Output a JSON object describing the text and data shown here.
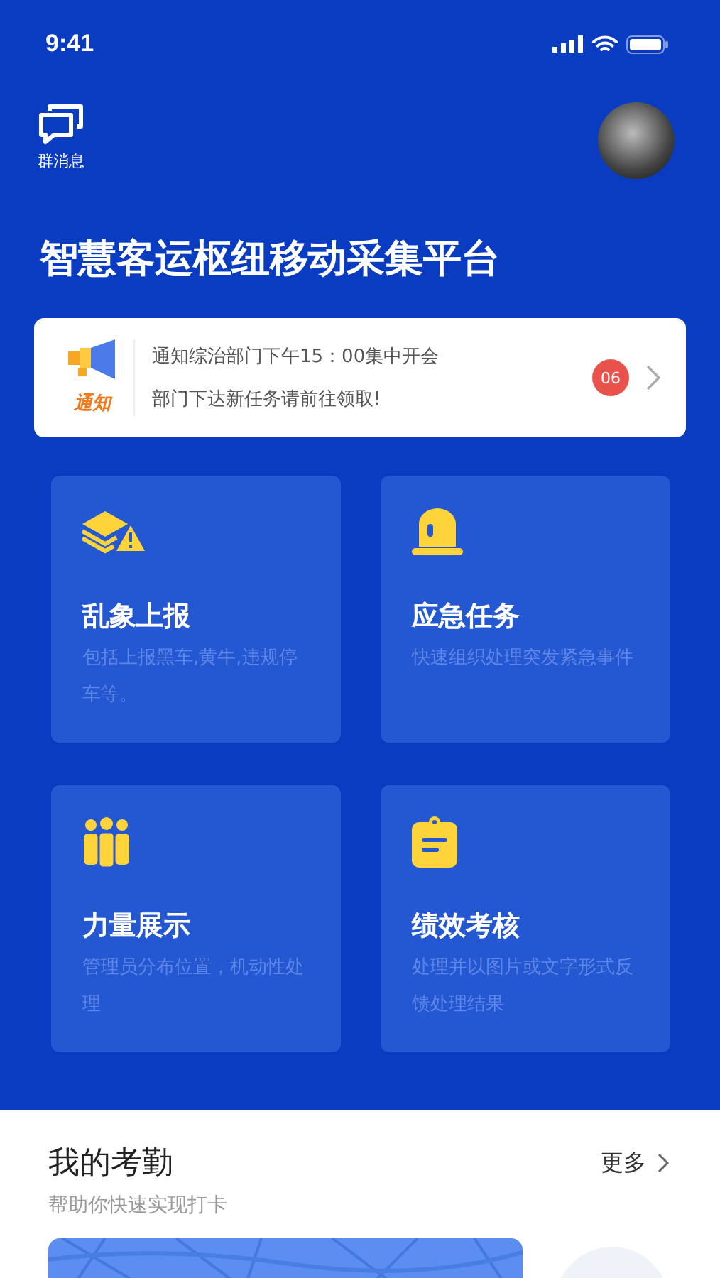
{
  "status_bar": {
    "time": "9:41"
  },
  "header": {
    "messages_label": "群消息"
  },
  "title": "智慧客运枢纽移动采集平台",
  "notice": {
    "badge_label": "通知",
    "lines": [
      "通知综治部门下午15：00集中开会",
      "部门下达新任务请前往领取!"
    ],
    "count": "06"
  },
  "tiles": [
    {
      "kind": "layers-warning",
      "title": "乱象上报",
      "description": "包括上报黑车,黄牛,违规停车等。"
    },
    {
      "kind": "beacon",
      "title": "应急任务",
      "description": "快速组织处理突发紧急事件"
    },
    {
      "kind": "people",
      "title": "力量展示",
      "description": "管理员分布位置，机动性处理"
    },
    {
      "kind": "clipboard",
      "title": "绩效考核",
      "description": "处理并以图片或文字形式反馈处理结果"
    }
  ],
  "attendance": {
    "title": "我的考勤",
    "subtitle": "帮助你快速实现打卡",
    "more": "更多"
  }
}
